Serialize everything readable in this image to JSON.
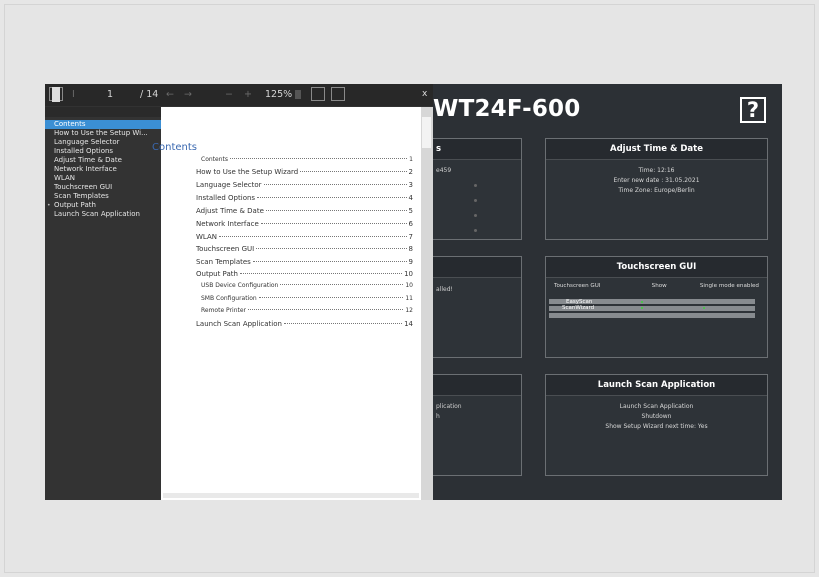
{
  "app": {
    "title": "WT24F-600",
    "help_label": "?",
    "panels": {
      "setup": {
        "partial_text": "s",
        "sub_text": "e459"
      },
      "time_date": {
        "title": "Adjust Time & Date",
        "lines": [
          "Time: 12:16",
          "Enter new date : 31.05.2021",
          "Time Zone: Europe/Berlin"
        ]
      },
      "scan": {
        "partial_text": "alled!"
      },
      "touchscreen": {
        "title": "Touchscreen GUI",
        "headers": [
          "Touchscreen GUI",
          "Show",
          "Single mode enabled"
        ],
        "rows": [
          "EasyScan",
          "ScanWizard"
        ]
      },
      "bottom_left": {
        "lines": [
          "plication",
          "h"
        ]
      },
      "launch": {
        "title": "Launch Scan Application",
        "lines": [
          "Launch Scan Application",
          "Shutdown",
          "Show Setup Wizard next time: Yes"
        ]
      }
    }
  },
  "viewer": {
    "page_current": "1",
    "page_total": "/ 14",
    "zoom": "125%",
    "close_label": "x",
    "sidebar": [
      "Contents",
      "How to Use the Setup Wi...",
      "Language Selector",
      "Installed Options",
      "Adjust Time & Date",
      "Network Interface",
      "WLAN",
      "Touchscreen GUI",
      "Scan Templates",
      "Output Path",
      "Launch Scan Application"
    ],
    "toc_title": "Contents",
    "toc": [
      {
        "label": "Contents",
        "page": "1"
      },
      {
        "label": "How to Use the Setup Wizard",
        "page": "2"
      },
      {
        "label": "Language Selector",
        "page": "3"
      },
      {
        "label": "Installed Options",
        "page": "4"
      },
      {
        "label": "Adjust Time & Date",
        "page": "5"
      },
      {
        "label": "Network Interface",
        "page": "6"
      },
      {
        "label": "WLAN",
        "page": "7"
      },
      {
        "label": "Touchscreen GUI",
        "page": "8"
      },
      {
        "label": "Scan Templates",
        "page": "9"
      },
      {
        "label": "Output Path",
        "page": "10"
      },
      {
        "label": "USB Device Configuration",
        "page": "10"
      },
      {
        "label": "SMB Configuration",
        "page": "11"
      },
      {
        "label": "Remote Printer",
        "page": "12"
      },
      {
        "label": "Launch Scan Application",
        "page": "14"
      }
    ]
  }
}
